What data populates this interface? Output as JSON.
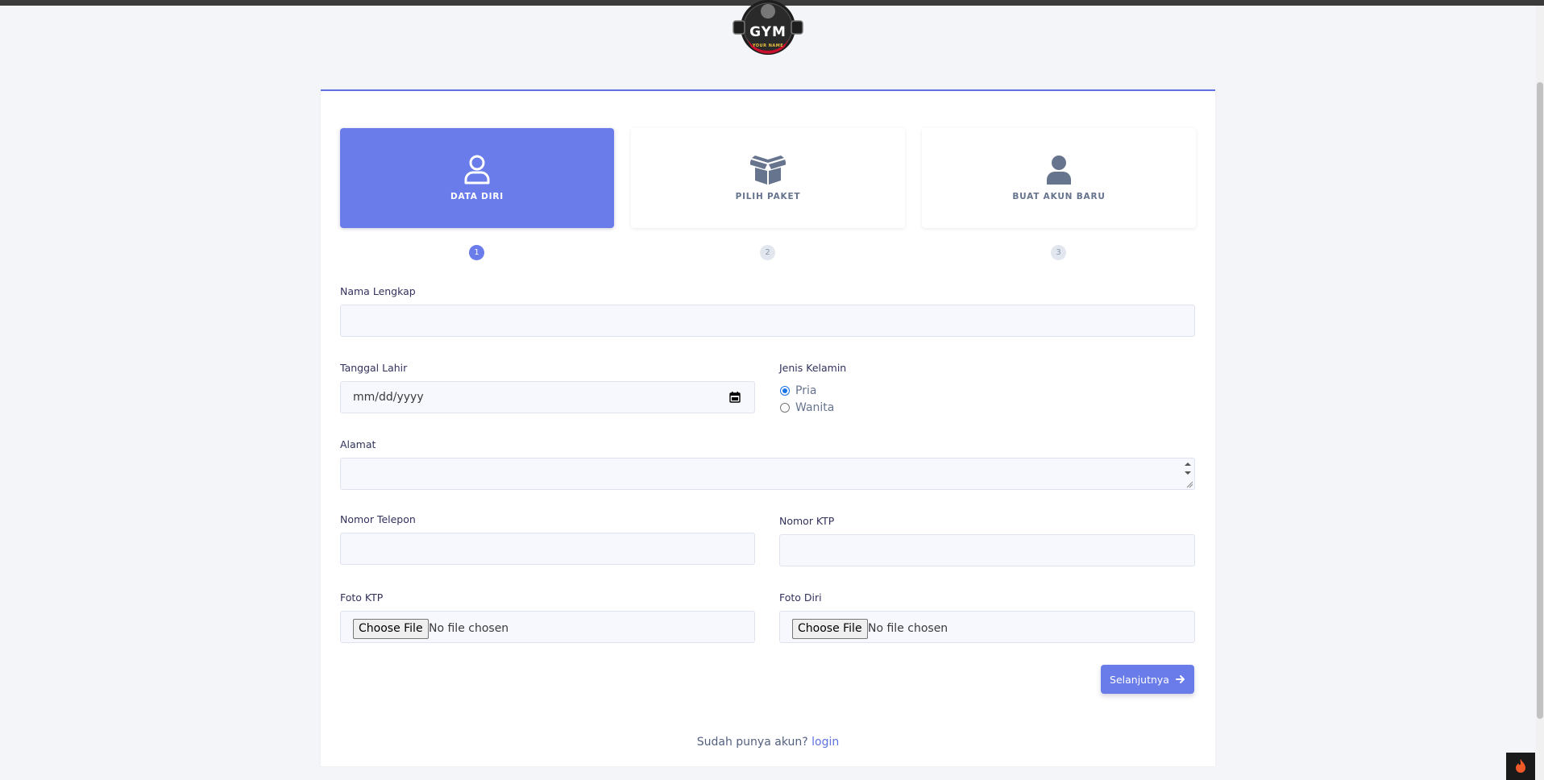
{
  "logo": {
    "text": "GYM",
    "subtext": "YOUR NAME"
  },
  "steps": [
    {
      "label": "DATA DIRI",
      "number": "1",
      "icon": "user-outline-icon",
      "active": true
    },
    {
      "label": "PILIH PAKET",
      "number": "2",
      "icon": "box-open-icon",
      "active": false
    },
    {
      "label": "BUAT AKUN BARU",
      "number": "3",
      "icon": "user-solid-icon",
      "active": false
    }
  ],
  "form": {
    "nama_lengkap": {
      "label": "Nama Lengkap",
      "value": ""
    },
    "tanggal_lahir": {
      "label": "Tanggal Lahir",
      "placeholder": "mm/dd/yyyy"
    },
    "jenis_kelamin": {
      "label": "Jenis Kelamin",
      "options": [
        "Pria",
        "Wanita"
      ],
      "selected": "Pria"
    },
    "alamat": {
      "label": "Alamat",
      "value": ""
    },
    "nomor_telepon": {
      "label": "Nomor Telepon",
      "value": ""
    },
    "nomor_ktp": {
      "label": "Nomor KTP",
      "value": ""
    },
    "foto_ktp": {
      "label": "Foto KTP",
      "button": "Choose File",
      "status": "No file chosen"
    },
    "foto_diri": {
      "label": "Foto Diri",
      "button": "Choose File",
      "status": "No file chosen"
    }
  },
  "next_button": {
    "label": "Selanjutnya",
    "icon": "arrow-right-icon"
  },
  "footer": {
    "text": "Sudah punya akun?",
    "link": "login"
  },
  "colors": {
    "primary": "#6a7cea",
    "background": "#f4f5f9",
    "link": "#5e72e4"
  }
}
